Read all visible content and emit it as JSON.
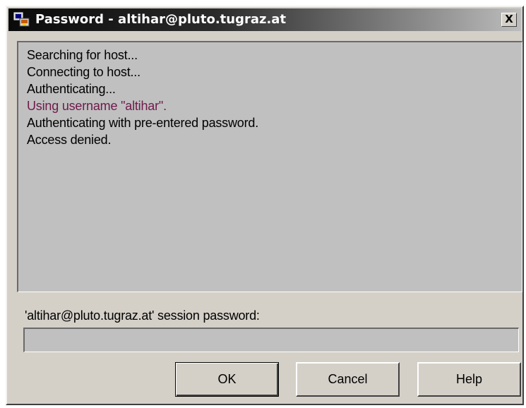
{
  "window": {
    "title": "Password - altihar@pluto.tugraz.at",
    "close_label": "X"
  },
  "log": {
    "lines": [
      "Searching for host...",
      "Connecting to host...",
      "Authenticating...",
      "Using username \"altihar\".",
      "Authenticating with pre-entered password.",
      "Access denied."
    ]
  },
  "password": {
    "label": "'altihar@pluto.tugraz.at' session password:",
    "value": ""
  },
  "buttons": {
    "ok": "OK",
    "cancel": "Cancel",
    "help": "Help"
  },
  "colors": {
    "window_bg": "#d4d0c8",
    "titlebar_start": "#0a0a0a",
    "titlebar_end": "#bdbdbd",
    "title_text": "#ffffff",
    "log_bg": "#c0c0c0",
    "log_highlight": "#6e1a4a"
  },
  "icons": {
    "app": "terminal-app-icon",
    "close": "close-icon"
  }
}
